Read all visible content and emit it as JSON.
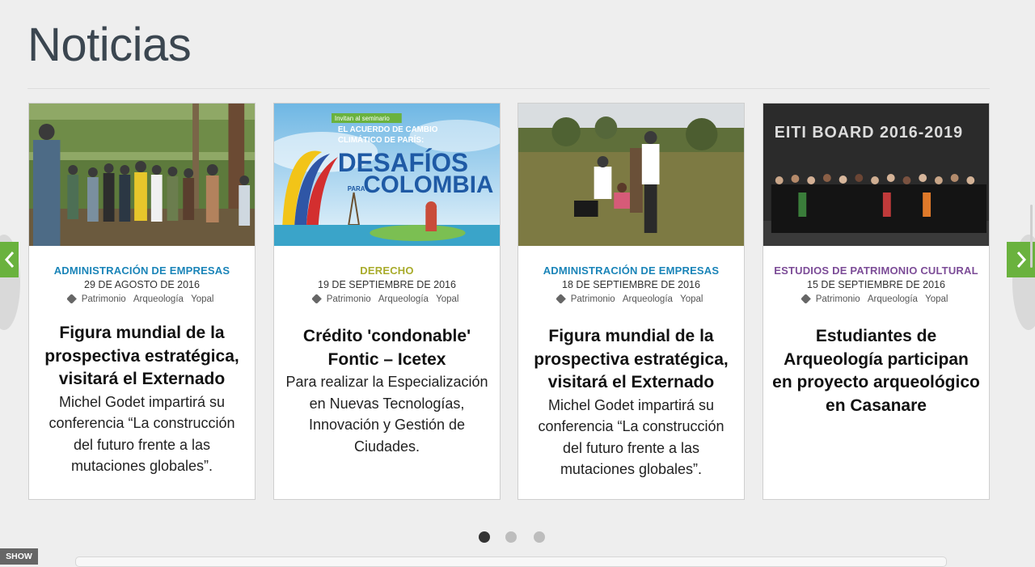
{
  "page": {
    "title": "Noticias"
  },
  "colors": {
    "accent_green": "#6ab23e",
    "cat_blue": "#1a84b8",
    "cat_olive": "#a8ab2a",
    "cat_purple": "#7c4c97"
  },
  "cards": [
    {
      "category": "ADMINISTRACIÓN DE  EMPRESAS",
      "category_color": "#1a84b8",
      "date": "29 DE AGOSTO DE 2016",
      "tags": [
        "Patrimonio",
        "Arqueología",
        "Yopal"
      ],
      "headline": "Figura mundial de la prospectiva estratégica, visitará el Externado",
      "excerpt": "Michel Godet impartirá su conferencia “La construcción del futuro frente a las mutaciones globales”.",
      "image": "forest-group-photo"
    },
    {
      "category": "DERECHO",
      "category_color": "#a8ab2a",
      "date": "19 DE SEPTIEMBRE DE 2016",
      "tags": [
        "Patrimonio",
        "Arqueología",
        "Yopal"
      ],
      "headline": "Crédito 'condonable' Fontic – Icetex",
      "excerpt": "Para realizar la Especialización en Nuevas Tecnologías, Innovación y Gestión de Ciudades.",
      "image": "paris-agreement-poster",
      "poster": {
        "kicker": "Invitan al seminario",
        "line1": "EL ACUERDO DE CAMBIO",
        "line2": "CLIMÁTICO DE PARÍS:",
        "big1": "DESAFÍOS",
        "small": "PARA",
        "big2": "COLOMBIA"
      }
    },
    {
      "category": "ADMINISTRACIÓN DE  EMPRESAS",
      "category_color": "#1a84b8",
      "date": "18 DE SEPTIEMBRE DE 2016",
      "tags": [
        "Patrimonio",
        "Arqueología",
        "Yopal"
      ],
      "headline": "Figura mundial de la prospectiva estratégica, visitará el Externado",
      "excerpt": "Michel Godet impartirá su conferencia “La construcción del futuro frente a las mutaciones globales”.",
      "image": "excavation-field-photo"
    },
    {
      "category": "ESTUDIOS DE PATRIMONIO CULTURAL",
      "category_color": "#7c4c97",
      "date": "15 DE SEPTIEMBRE DE 2016",
      "tags": [
        "Patrimonio",
        "Arqueología",
        "Yopal"
      ],
      "headline": "Estudiantes de Arqueología participan en proyecto arqueológico en Casanare",
      "excerpt": "",
      "image": "eiti-board-group-photo",
      "banner": "EITI BOARD 2016-2019"
    }
  ],
  "carousel": {
    "pages": 3,
    "active": 1
  },
  "show_tab": "SHOW"
}
